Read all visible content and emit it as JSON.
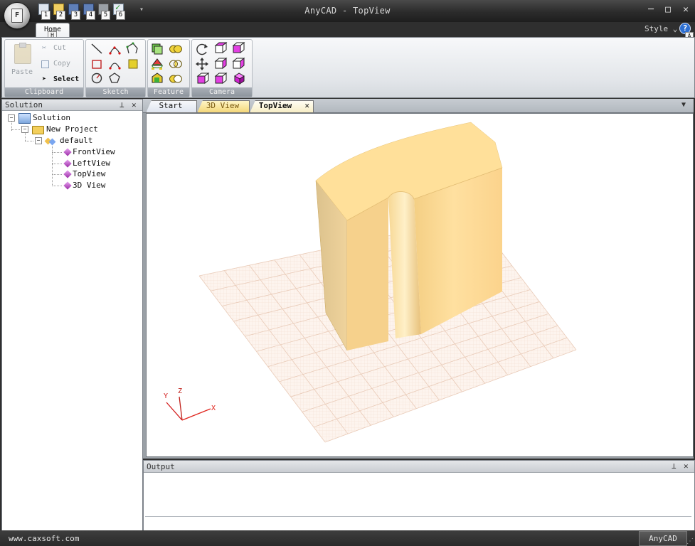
{
  "window": {
    "title": "AnyCAD - TopView"
  },
  "quick_access": {
    "items": [
      {
        "icon": "new-file-icon",
        "key": "1"
      },
      {
        "icon": "open-folder-icon",
        "key": "2"
      },
      {
        "icon": "save-disk-icon",
        "key": "3"
      },
      {
        "icon": "save-as-disk-icon",
        "key": "4"
      },
      {
        "icon": "print-icon",
        "key": "5"
      },
      {
        "icon": "check-icon",
        "key": "6"
      }
    ],
    "app_button_letter": "F"
  },
  "ribbon": {
    "tabs": [
      {
        "label": "Home",
        "key": "H"
      }
    ],
    "style_menu": "Style",
    "help_key": "A",
    "groups": {
      "clipboard": {
        "label": "Clipboard",
        "paste": "Paste",
        "cut": "Cut",
        "copy": "Copy",
        "select": "Select"
      },
      "sketch": {
        "label": "Sketch"
      },
      "feature": {
        "label": "Feature"
      },
      "camera": {
        "label": "Camera"
      }
    }
  },
  "solution": {
    "title": "Solution",
    "tree": {
      "root": "Solution",
      "project": "New Project",
      "item": "default",
      "views": [
        "FrontView",
        "LeftView",
        "TopView",
        "3D View"
      ]
    }
  },
  "documents": {
    "tabs": [
      {
        "label": "Start"
      },
      {
        "label": "3D View"
      },
      {
        "label": "TopView",
        "active": true
      }
    ]
  },
  "axes": {
    "x": "X",
    "y": "Y",
    "z": "Z"
  },
  "output": {
    "title": "Output"
  },
  "status": {
    "url": "www.caxsoft.com",
    "app": "AnyCAD"
  },
  "colors": {
    "model_face": "#ffe09a",
    "grid": "#f1c9b4",
    "x_axis": "#e0241c",
    "y_axis": "#d31f1f",
    "z_axis": "#c0201a"
  }
}
